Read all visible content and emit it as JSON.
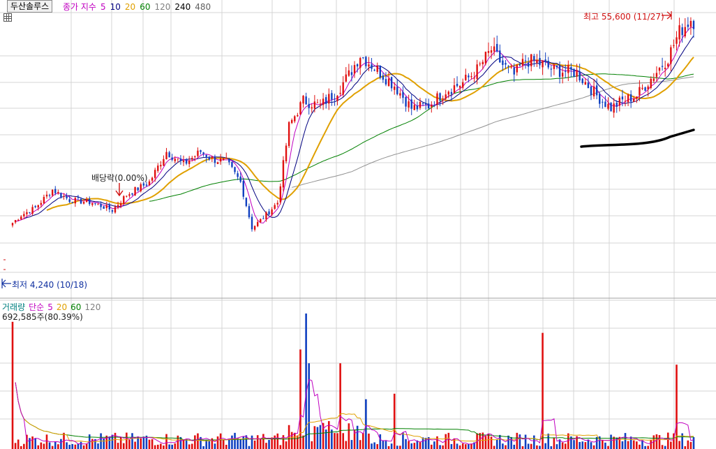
{
  "header": {
    "stock_name": "두산솔루스",
    "ma_legend": [
      {
        "label": "종가 지수",
        "color": "#c000c0"
      },
      {
        "label": "5",
        "color": "#c000c0"
      },
      {
        "label": "10",
        "color": "#000080"
      },
      {
        "label": "20",
        "color": "#e0a000"
      },
      {
        "label": "60",
        "color": "#008000"
      },
      {
        "label": "120",
        "color": "#808080"
      },
      {
        "label": "240",
        "color": "#000000"
      },
      {
        "label": "480",
        "color": "#606060"
      }
    ]
  },
  "annotations": {
    "high_label": "최고 55,600 (11/27)",
    "low_label": "최저 4,240 (10/18)",
    "dividend_label": "배당락(0.00%)"
  },
  "volume_panel": {
    "legend": [
      {
        "label": "거래량",
        "color": "#008080"
      },
      {
        "label": "단순",
        "color": "#c000c0"
      },
      {
        "label": "5",
        "color": "#c000c0"
      },
      {
        "label": "20",
        "color": "#e0a000"
      },
      {
        "label": "60",
        "color": "#008000"
      },
      {
        "label": "120",
        "color": "#808080"
      }
    ],
    "current_value": "692,585주(80.39%)"
  },
  "colors": {
    "up": "#e01010",
    "down": "#1040c0",
    "grid": "#d4d4d4",
    "ma5": "#c000c0",
    "ma10": "#000080",
    "ma20": "#e0a000",
    "ma60": "#008000",
    "ma120": "#909090",
    "trend": "#000000"
  },
  "chart_data": {
    "type": "candlestick",
    "price_anchors": [
      [
        0,
        16000
      ],
      [
        3,
        17500
      ],
      [
        8,
        19000
      ],
      [
        14,
        22500
      ],
      [
        20,
        20500
      ],
      [
        28,
        20000
      ],
      [
        35,
        18500
      ],
      [
        40,
        21500
      ],
      [
        48,
        24000
      ],
      [
        54,
        30000
      ],
      [
        60,
        27500
      ],
      [
        66,
        30000
      ],
      [
        70,
        28500
      ],
      [
        75,
        28000
      ],
      [
        80,
        24000
      ],
      [
        84,
        15000
      ],
      [
        88,
        17000
      ],
      [
        93,
        20000
      ],
      [
        97,
        35000
      ],
      [
        102,
        40000
      ],
      [
        108,
        39000
      ],
      [
        114,
        42000
      ],
      [
        118,
        45000
      ],
      [
        122,
        49000
      ],
      [
        128,
        46000
      ],
      [
        134,
        43000
      ],
      [
        140,
        38500
      ],
      [
        146,
        39000
      ],
      [
        152,
        42000
      ],
      [
        158,
        43500
      ],
      [
        163,
        46000
      ],
      [
        168,
        50000
      ],
      [
        172,
        47000
      ],
      [
        176,
        45000
      ],
      [
        180,
        48000
      ],
      [
        184,
        47500
      ],
      [
        190,
        46000
      ],
      [
        198,
        45500
      ],
      [
        205,
        41000
      ],
      [
        210,
        38500
      ],
      [
        214,
        40000
      ],
      [
        219,
        41000
      ],
      [
        225,
        45000
      ],
      [
        230,
        48500
      ],
      [
        234,
        53500
      ],
      [
        238,
        56000
      ],
      [
        239,
        55600
      ]
    ],
    "candle_count": 240,
    "volume_spikes": [
      [
        0,
        0.92
      ],
      [
        101,
        0.72
      ],
      [
        103,
        0.98
      ],
      [
        104,
        0.62
      ],
      [
        115,
        0.62
      ],
      [
        124,
        0.36
      ],
      [
        134,
        0.4
      ],
      [
        186,
        0.84
      ],
      [
        233,
        0.61
      ]
    ],
    "high": {
      "value": 55600,
      "date": "11/27"
    },
    "low": {
      "value": 4240,
      "date": "10/18"
    }
  }
}
